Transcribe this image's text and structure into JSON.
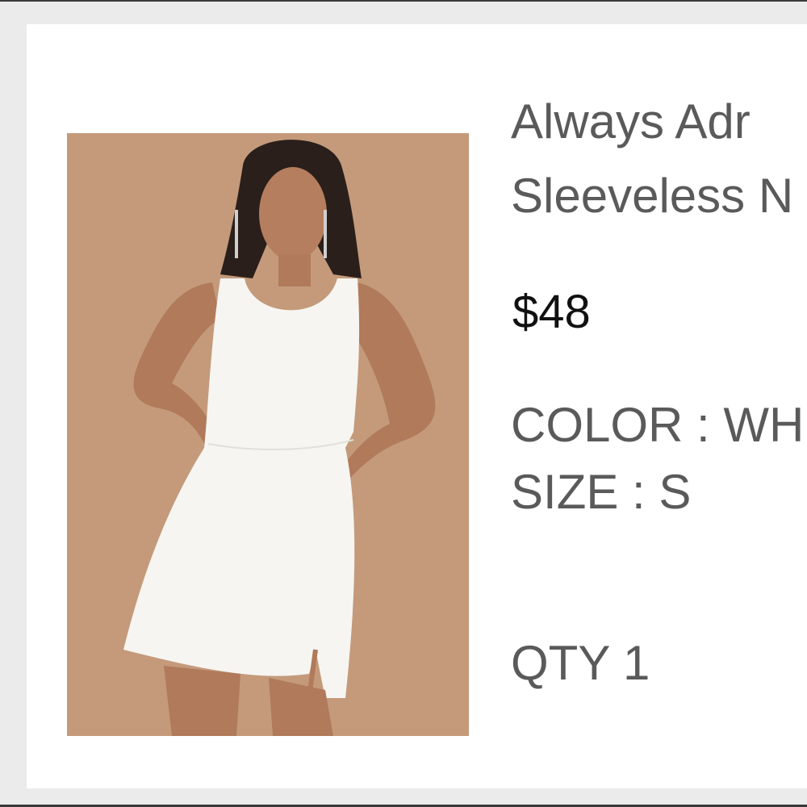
{
  "product": {
    "image_alt": "Model wearing white sleeveless mini dress",
    "title_line_1": "Always Adr",
    "title_line_2": "Sleeveless N",
    "price": "$48",
    "color_label": "COLOR",
    "color_value": "WH",
    "size_label": "SIZE",
    "size_value": "S",
    "qty_label": "QTY",
    "qty_value": "1"
  },
  "colors": {
    "background": "#ebebeb",
    "card": "#ffffff",
    "image_backdrop": "#c49a7b",
    "text_gray": "#5a5a5a",
    "price_text": "#111111"
  }
}
